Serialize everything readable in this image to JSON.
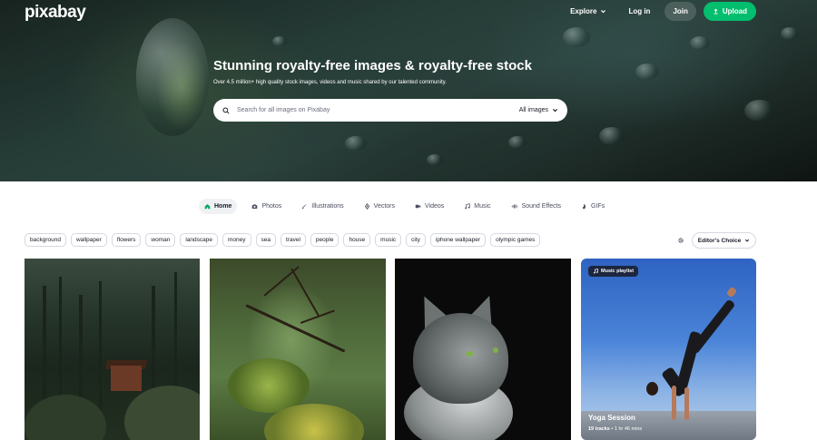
{
  "header": {
    "logo": "pixabay",
    "explore_label": "Explore",
    "login_label": "Log in",
    "join_label": "Join",
    "upload_label": "Upload"
  },
  "hero": {
    "title": "Stunning royalty-free images & royalty-free stock",
    "subtitle": "Over 4.5 million+ high quality stock images, videos and music shared by our talented community.",
    "search_placeholder": "Search for all images on Pixabay",
    "search_type": "All images"
  },
  "tabs": [
    {
      "label": "Home",
      "icon": "home-icon",
      "active": true
    },
    {
      "label": "Photos",
      "icon": "camera-icon"
    },
    {
      "label": "Illustrations",
      "icon": "brush-icon"
    },
    {
      "label": "Vectors",
      "icon": "pen-icon"
    },
    {
      "label": "Videos",
      "icon": "video-icon"
    },
    {
      "label": "Music",
      "icon": "music-icon"
    },
    {
      "label": "Sound Effects",
      "icon": "soundwave-icon"
    },
    {
      "label": "GIFs",
      "icon": "gif-icon"
    }
  ],
  "tags": [
    "background",
    "wallpaper",
    "flowers",
    "woman",
    "landscape",
    "money",
    "sea",
    "travel",
    "people",
    "house",
    "music",
    "city",
    "iphone wallpaper",
    "olympic games"
  ],
  "filter": {
    "sort_label": "Editor's Choice"
  },
  "cards": {
    "playlist": {
      "badge": "Music playlist",
      "title": "Yoga Session",
      "tracks": "19 tracks",
      "duration": "1 hr 46 mins"
    }
  },
  "colors": {
    "accent": "#02be6e",
    "text": "#191b26"
  }
}
